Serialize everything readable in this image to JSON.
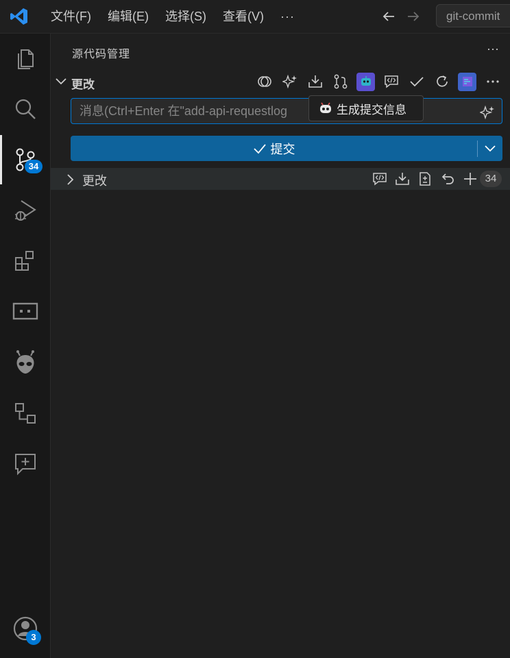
{
  "titlebar": {
    "menu": [
      "文件(F)",
      "编辑(E)",
      "选择(S)",
      "查看(V)"
    ],
    "more": "···",
    "command_center": "git-commit"
  },
  "activity": {
    "scm_badge": "34",
    "accounts_badge": "3"
  },
  "panel": {
    "title": "源代码管理",
    "more": "···",
    "section_title": "更改",
    "message_placeholder": "消息(Ctrl+Enter 在\"add-api-requestlog",
    "tooltip": "生成提交信息",
    "commit_label": "提交",
    "changes_group": {
      "label": "更改",
      "count": "34"
    }
  },
  "colors": {
    "accent": "#0078d4",
    "commit_button": "#0e639c",
    "background": "#1f1f1f",
    "activity_bar": "#181818"
  }
}
